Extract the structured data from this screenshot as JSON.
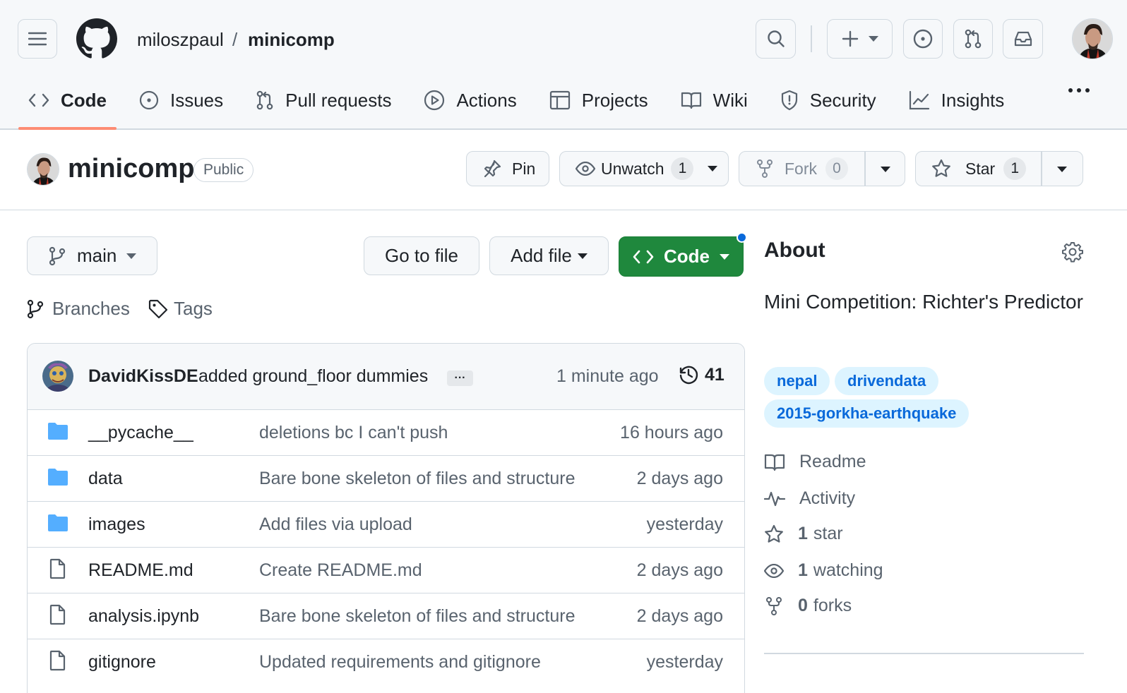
{
  "header": {
    "owner": "miloszpaul",
    "separator": "/",
    "repo": "minicomp"
  },
  "nav": {
    "tabs": [
      {
        "label": "Code",
        "icon": "code-icon",
        "selected": true
      },
      {
        "label": "Issues",
        "icon": "issue-opened-icon"
      },
      {
        "label": "Pull requests",
        "icon": "git-pull-request-icon"
      },
      {
        "label": "Actions",
        "icon": "play-icon"
      },
      {
        "label": "Projects",
        "icon": "table-icon"
      },
      {
        "label": "Wiki",
        "icon": "book-icon"
      },
      {
        "label": "Security",
        "icon": "shield-icon"
      },
      {
        "label": "Insights",
        "icon": "graph-icon"
      }
    ]
  },
  "repo": {
    "name": "minicomp",
    "visibility": "Public",
    "pin_label": "Pin",
    "watch_label": "Unwatch",
    "watch_count": "1",
    "fork_label": "Fork",
    "fork_count": "0",
    "star_label": "Star",
    "star_count": "1"
  },
  "toolbar": {
    "branch": "main",
    "go_to_file": "Go to file",
    "add_file": "Add file",
    "code": "Code",
    "branches_label": "Branches",
    "tags_label": "Tags"
  },
  "commit": {
    "author": "DavidKissDE",
    "message": "added ground_floor dummies",
    "ellipsis": "···",
    "time": "1 minute ago",
    "count": "41"
  },
  "files": [
    {
      "name": "__pycache__",
      "type": "folder",
      "message": "deletions bc I can't push",
      "time": "16 hours ago"
    },
    {
      "name": "data",
      "type": "folder",
      "message": "Bare bone skeleton of files and structure",
      "time": "2 days ago"
    },
    {
      "name": "images",
      "type": "folder",
      "message": "Add files via upload",
      "time": "yesterday"
    },
    {
      "name": "README.md",
      "type": "file",
      "message": "Create README.md",
      "time": "2 days ago"
    },
    {
      "name": "analysis.ipynb",
      "type": "file",
      "message": "Bare bone skeleton of files and structure",
      "time": "2 days ago"
    },
    {
      "name": "gitignore",
      "type": "file",
      "message": "Updated requirements and gitignore",
      "time": "yesterday"
    }
  ],
  "about": {
    "heading": "About",
    "description": "Mini Competition: Richter's Predictor",
    "topics": [
      "nepal",
      "drivendata",
      "2015-gorkha-earthquake"
    ],
    "readme": "Readme",
    "activity": "Activity",
    "stars_num": "1",
    "stars_label": "star",
    "watching_num": "1",
    "watching_label": "watching",
    "forks_num": "0",
    "forks_label": "forks"
  },
  "colors": {
    "accent_underline": "#fd8c73",
    "green_button": "#1f883d",
    "topic_bg": "#ddf4ff",
    "topic_text": "#0969da",
    "folder": "#54aeff",
    "notification_dot": "#0969da"
  }
}
